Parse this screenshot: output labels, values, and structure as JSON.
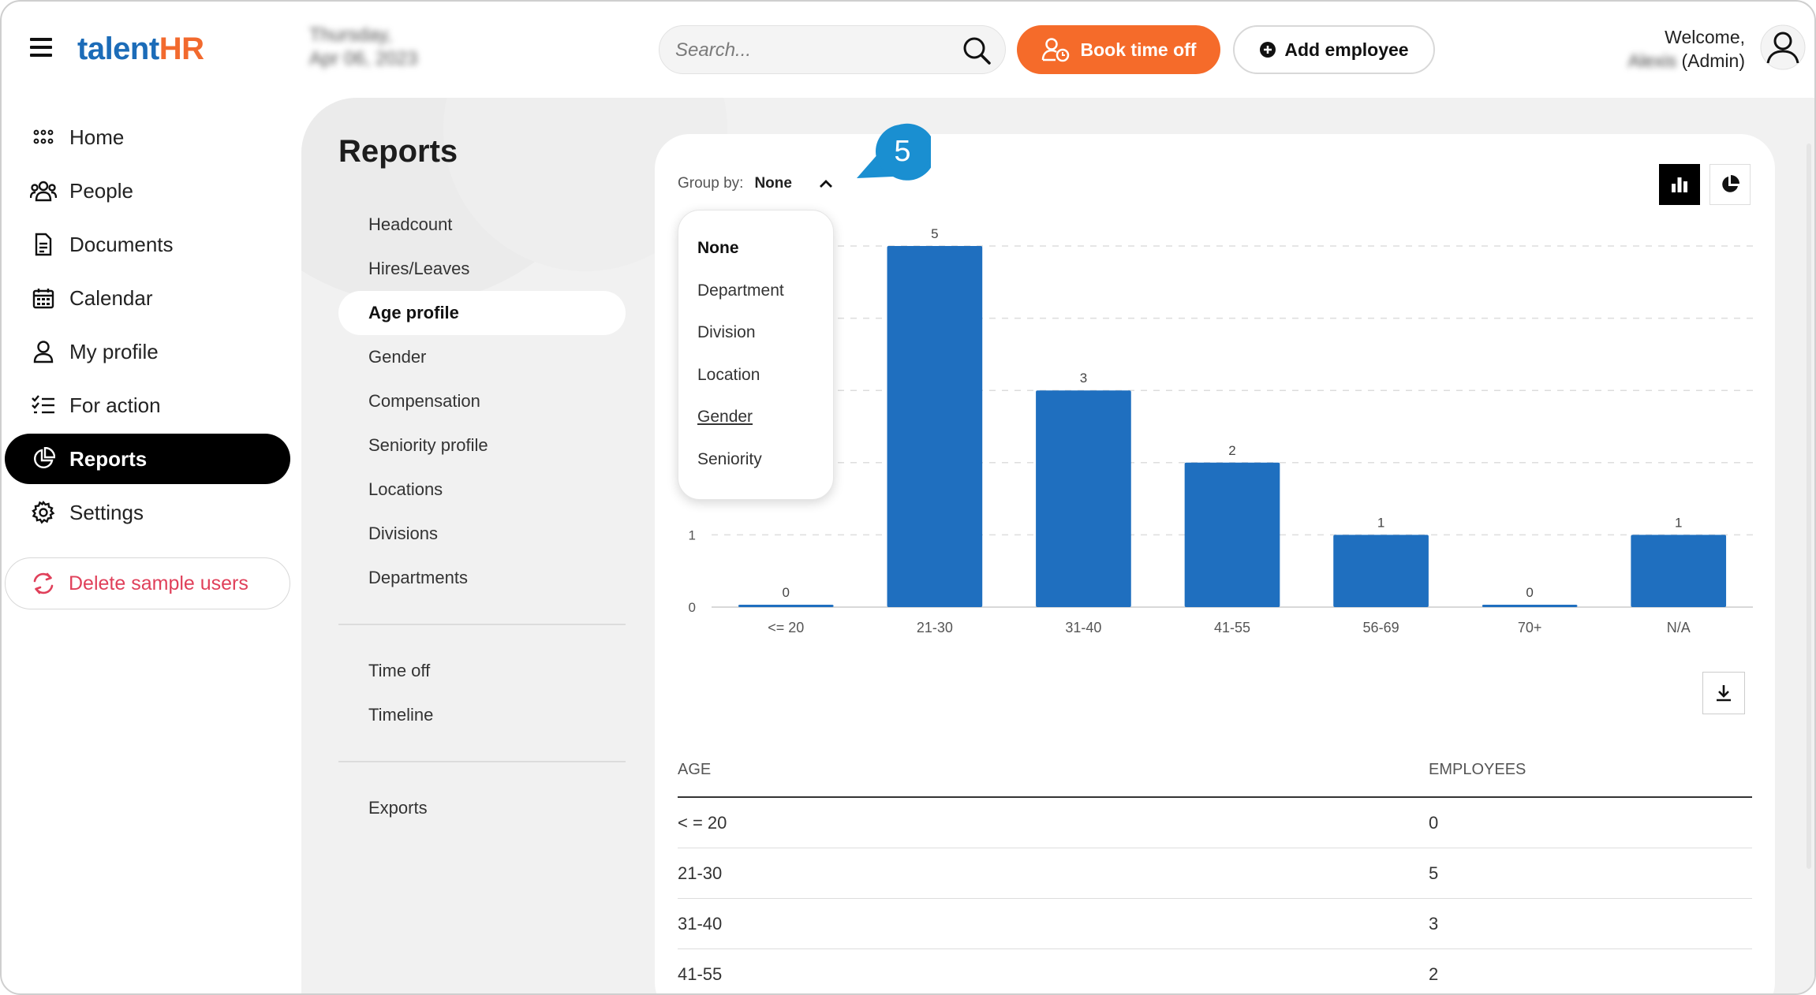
{
  "app": {
    "logo_part1": "talent",
    "logo_part2": "HR",
    "date_line1": "Thursday,",
    "date_line2": "Apr 06, 2023"
  },
  "search": {
    "placeholder": "Search..."
  },
  "header": {
    "book_time_off": "Book time off",
    "add_employee": "Add employee",
    "welcome": "Welcome,",
    "user_name": "Alexis",
    "user_role": "(Admin)"
  },
  "nav": {
    "items": [
      {
        "label": "Home",
        "icon": "home-grid-icon"
      },
      {
        "label": "People",
        "icon": "people-icon"
      },
      {
        "label": "Documents",
        "icon": "document-icon"
      },
      {
        "label": "Calendar",
        "icon": "calendar-icon"
      },
      {
        "label": "My profile",
        "icon": "user-icon"
      },
      {
        "label": "For action",
        "icon": "checklist-icon"
      },
      {
        "label": "Reports",
        "icon": "pie-chart-icon",
        "active": true
      },
      {
        "label": "Settings",
        "icon": "gear-icon"
      }
    ],
    "delete_sample_users": "Delete sample users"
  },
  "reports": {
    "title": "Reports",
    "group1": [
      "Headcount",
      "Hires/Leaves",
      "Age profile",
      "Gender",
      "Compensation",
      "Seniority profile",
      "Locations",
      "Divisions",
      "Departments"
    ],
    "group2": [
      "Time off",
      "Timeline"
    ],
    "group3": [
      "Exports"
    ],
    "active": "Age profile"
  },
  "groupby": {
    "label": "Group by:",
    "value": "None",
    "options": [
      "None",
      "Department",
      "Division",
      "Location",
      "Gender",
      "Seniority"
    ],
    "hovered": "Gender"
  },
  "step_badge": "5",
  "colors": {
    "bar": "#1f6fbf",
    "accent": "#f56b2a",
    "badge": "#1a8fd1"
  },
  "chart_data": {
    "type": "bar",
    "categories": [
      "<= 20",
      "21-30",
      "31-40",
      "41-55",
      "56-69",
      "70+",
      "N/A"
    ],
    "values": [
      0,
      5,
      3,
      2,
      1,
      0,
      1
    ],
    "ylim": [
      0,
      5
    ],
    "yticks": [
      "0",
      "1"
    ],
    "grid": true
  },
  "table": {
    "headers": [
      "AGE",
      "EMPLOYEES"
    ],
    "rows": [
      [
        "< = 20",
        "0"
      ],
      [
        "21-30",
        "5"
      ],
      [
        "31-40",
        "3"
      ],
      [
        "41-55",
        "2"
      ]
    ]
  }
}
